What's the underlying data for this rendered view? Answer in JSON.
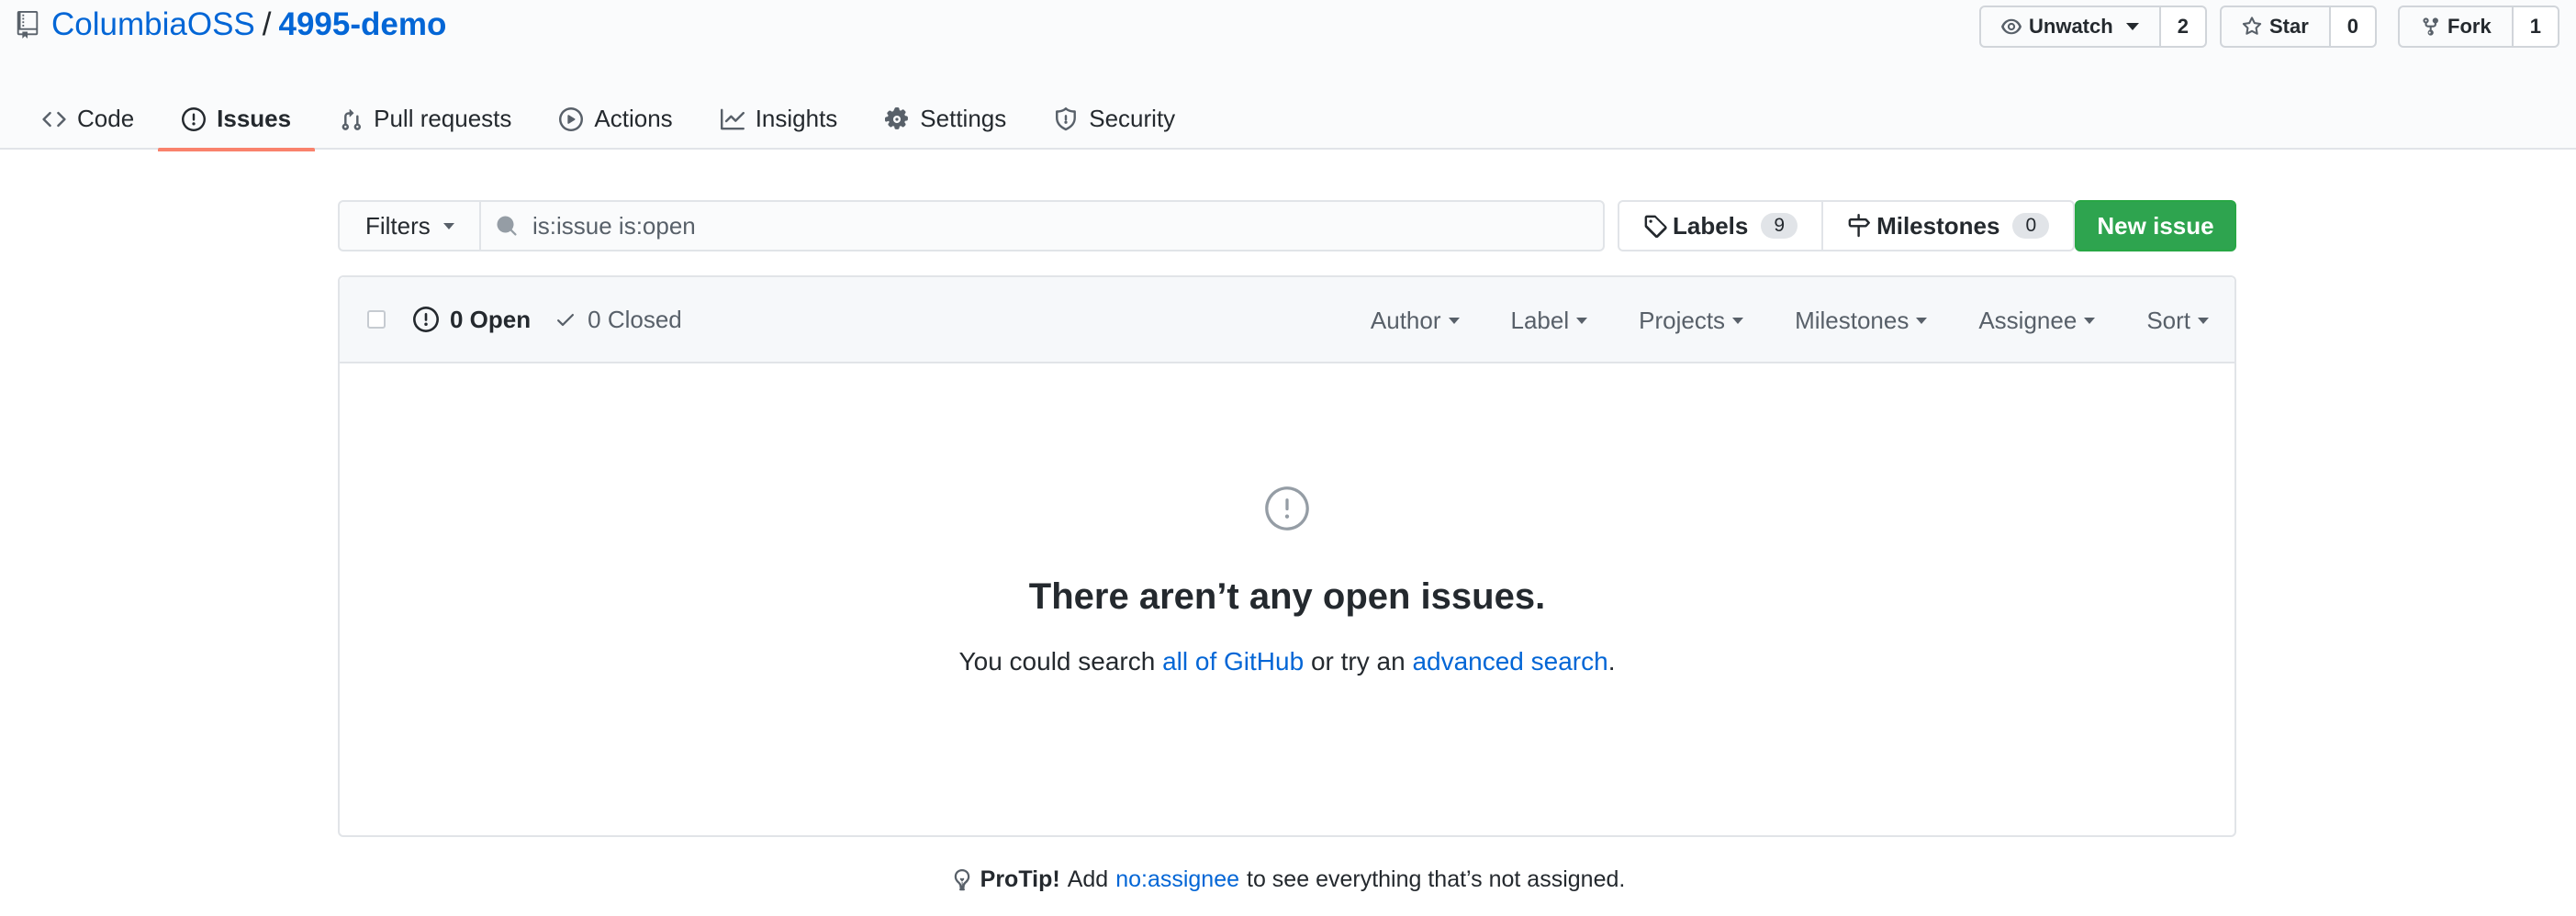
{
  "repo": {
    "owner": "ColumbiaOSS",
    "separator": "/",
    "name": "4995-demo"
  },
  "actions": {
    "watch": {
      "label": "Unwatch",
      "count": "2"
    },
    "star": {
      "label": "Star",
      "count": "0"
    },
    "fork": {
      "label": "Fork",
      "count": "1"
    }
  },
  "nav": {
    "code": "Code",
    "issues": "Issues",
    "pulls": "Pull requests",
    "actions": "Actions",
    "insights": "Insights",
    "settings": "Settings",
    "security": "Security"
  },
  "subnav": {
    "filters_label": "Filters",
    "search_value": "is:issue is:open",
    "labels_label": "Labels",
    "labels_count": "9",
    "milestones_label": "Milestones",
    "milestones_count": "0",
    "new_issue_label": "New issue"
  },
  "box_header": {
    "open_label": "0 Open",
    "closed_label": "0 Closed",
    "menus": {
      "author": "Author",
      "label": "Label",
      "projects": "Projects",
      "milestones": "Milestones",
      "assignee": "Assignee",
      "sort": "Sort"
    }
  },
  "blankslate": {
    "title": "There aren’t any open issues.",
    "text_before": "You could search ",
    "link1": "all of GitHub",
    "text_middle": " or try an ",
    "link2": "advanced search",
    "text_after": "."
  },
  "protip": {
    "bold": "ProTip!",
    "before": "Add",
    "link": "no:assignee",
    "after": "to see everything that’s not assigned."
  },
  "colors": {
    "link": "#0366d6",
    "primary_green": "#2ea44f",
    "tab_underline": "#f9826c"
  }
}
